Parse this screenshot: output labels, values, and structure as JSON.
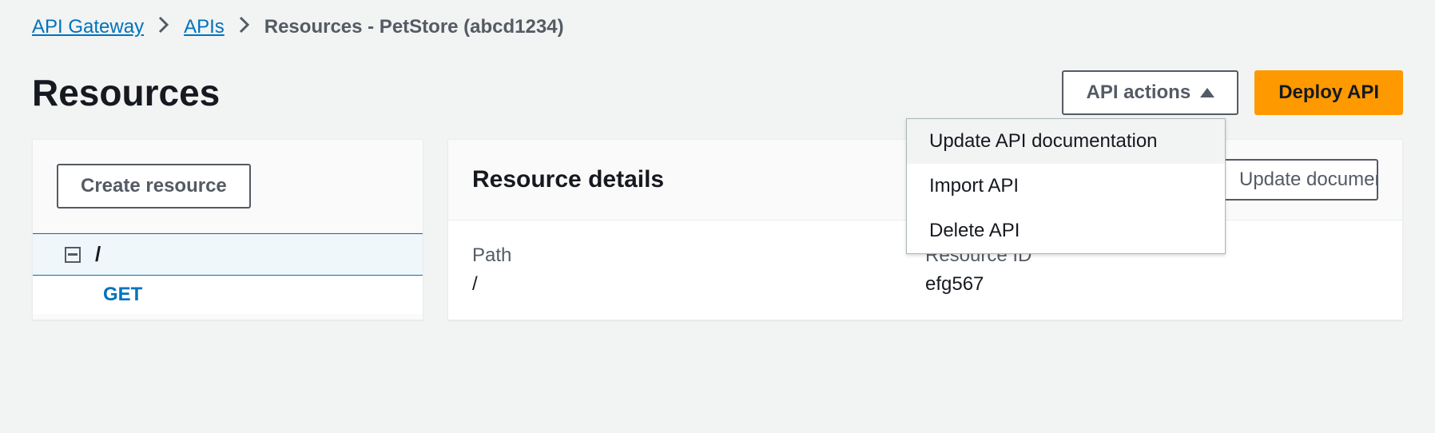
{
  "breadcrumb": {
    "root": "API Gateway",
    "apis": "APIs",
    "current": "Resources - PetStore (abcd1234)"
  },
  "page_title": "Resources",
  "header": {
    "api_actions_label": "API actions",
    "deploy_label": "Deploy API"
  },
  "api_actions_menu": {
    "update_docs": "Update API documentation",
    "import_api": "Import API",
    "delete_api": "Delete API"
  },
  "left_panel": {
    "create_resource_label": "Create resource",
    "root_path": "/",
    "method_get": "GET"
  },
  "right_panel": {
    "title": "Resource details",
    "update_doc_label": "Update documentation",
    "path_label": "Path",
    "path_value": "/",
    "resource_id_label": "Resource ID",
    "resource_id_value": "efg567"
  }
}
